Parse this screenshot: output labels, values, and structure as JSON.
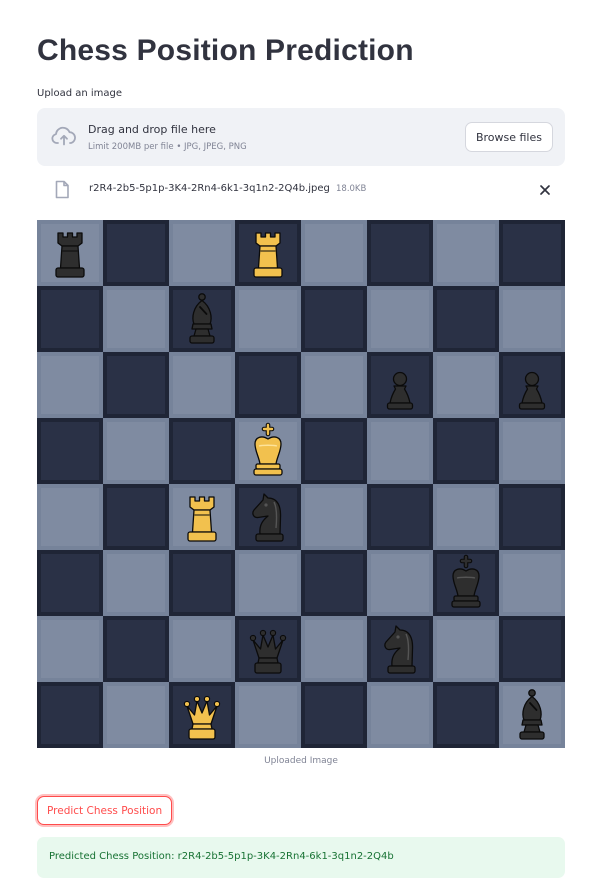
{
  "page": {
    "title": "Chess Position Prediction"
  },
  "uploader": {
    "label": "Upload an image",
    "drop_title": "Drag and drop file here",
    "limit_text": "Limit 200MB per file • JPG, JPEG, PNG",
    "browse_label": "Browse files",
    "icon": "cloud-upload-icon"
  },
  "file": {
    "name": "r2R4-2b5-5p1p-3K4-2Rn4-6k1-3q1n2-2Q4b.jpeg",
    "size": "18.0KB",
    "icon": "file-icon",
    "remove_icon": "close-icon"
  },
  "board": {
    "fen": "r2R4/2b5/5p1p/3K4/2Rn4/6k1/3q1n2/2Q4b",
    "light_square_color": "#7f8ba1",
    "dark_square_color": "#2a3146",
    "white_piece_color": "#f2c14e",
    "black_piece_color": "#2e2e2e"
  },
  "image_caption": "Uploaded Image",
  "predict_button": {
    "label": "Predict Chess Position",
    "accent": "#ff4b4b"
  },
  "result": {
    "text": "Predicted Chess Position: r2R4-2b5-5p1p-3K4-2Rn4-6k1-3q1n2-2Q4b",
    "text_color": "#177233",
    "background": "#e8f9ee"
  }
}
